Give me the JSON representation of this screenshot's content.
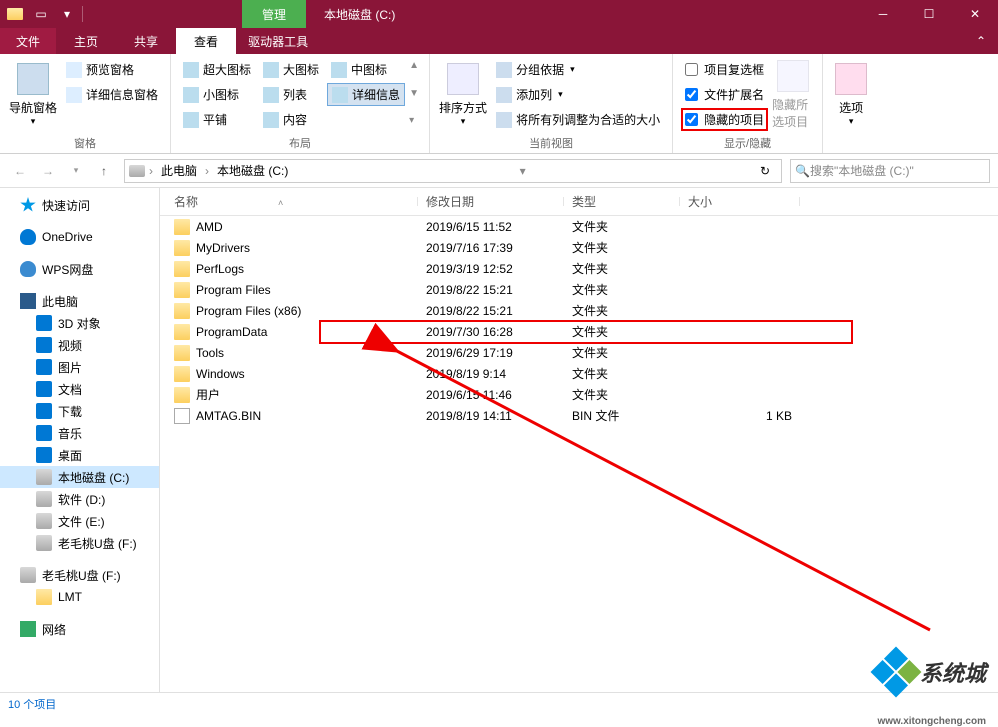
{
  "window": {
    "title": "本地磁盘 (C:)",
    "manage_tab": "管理"
  },
  "tabs": {
    "file": "文件",
    "home": "主页",
    "share": "共享",
    "view": "查看",
    "drive_tools": "驱动器工具"
  },
  "ribbon": {
    "panes": {
      "nav_pane": "导航窗格",
      "preview": "预览窗格",
      "details": "详细信息窗格",
      "group_label": "窗格"
    },
    "layout": {
      "extra_large": "超大图标",
      "large": "大图标",
      "medium": "中图标",
      "small": "小图标",
      "list": "列表",
      "details": "详细信息",
      "tiles": "平铺",
      "content": "内容",
      "group_label": "布局"
    },
    "current_view": {
      "sort_by": "排序方式",
      "group_by": "分组依据",
      "add_columns": "添加列",
      "autosize": "将所有列调整为合适的大小",
      "group_label": "当前视图"
    },
    "show_hide": {
      "item_checkboxes": "项目复选框",
      "file_ext": "文件扩展名",
      "hidden_items": "隐藏的项目",
      "hide_selected": "隐藏所选项目",
      "group_label": "显示/隐藏"
    },
    "options": "选项"
  },
  "address": {
    "root": "此电脑",
    "current": "本地磁盘 (C:)"
  },
  "search": {
    "placeholder": "搜索\"本地磁盘 (C:)\""
  },
  "columns": {
    "name": "名称",
    "date": "修改日期",
    "type": "类型",
    "size": "大小"
  },
  "sidebar": {
    "quick_access": "快速访问",
    "onedrive": "OneDrive",
    "wps": "WPS网盘",
    "this_pc": "此电脑",
    "items": [
      {
        "label": "3D 对象"
      },
      {
        "label": "视频"
      },
      {
        "label": "图片"
      },
      {
        "label": "文档"
      },
      {
        "label": "下载"
      },
      {
        "label": "音乐"
      },
      {
        "label": "桌面"
      },
      {
        "label": "本地磁盘 (C:)"
      },
      {
        "label": "软件 (D:)"
      },
      {
        "label": "文件 (E:)"
      },
      {
        "label": "老毛桃U盘 (F:)"
      }
    ],
    "removable": "老毛桃U盘 (F:)",
    "lmt": "LMT",
    "network": "网络"
  },
  "files": [
    {
      "name": "AMD",
      "date": "2019/6/15 11:52",
      "type": "文件夹",
      "size": ""
    },
    {
      "name": "MyDrivers",
      "date": "2019/7/16 17:39",
      "type": "文件夹",
      "size": ""
    },
    {
      "name": "PerfLogs",
      "date": "2019/3/19 12:52",
      "type": "文件夹",
      "size": ""
    },
    {
      "name": "Program Files",
      "date": "2019/8/22 15:21",
      "type": "文件夹",
      "size": ""
    },
    {
      "name": "Program Files (x86)",
      "date": "2019/8/22 15:21",
      "type": "文件夹",
      "size": ""
    },
    {
      "name": "ProgramData",
      "date": "2019/7/30 16:28",
      "type": "文件夹",
      "size": ""
    },
    {
      "name": "Tools",
      "date": "2019/6/29 17:19",
      "type": "文件夹",
      "size": ""
    },
    {
      "name": "Windows",
      "date": "2019/8/19 9:14",
      "type": "文件夹",
      "size": ""
    },
    {
      "name": "用户",
      "date": "2019/6/15 11:46",
      "type": "文件夹",
      "size": ""
    },
    {
      "name": "AMTAG.BIN",
      "date": "2019/8/19 14:11",
      "type": "BIN 文件",
      "size": "1 KB",
      "file": true
    }
  ],
  "status": {
    "count": "10 个项目"
  },
  "watermark": {
    "text": "系统城",
    "url": "www.xitongcheng.com"
  }
}
